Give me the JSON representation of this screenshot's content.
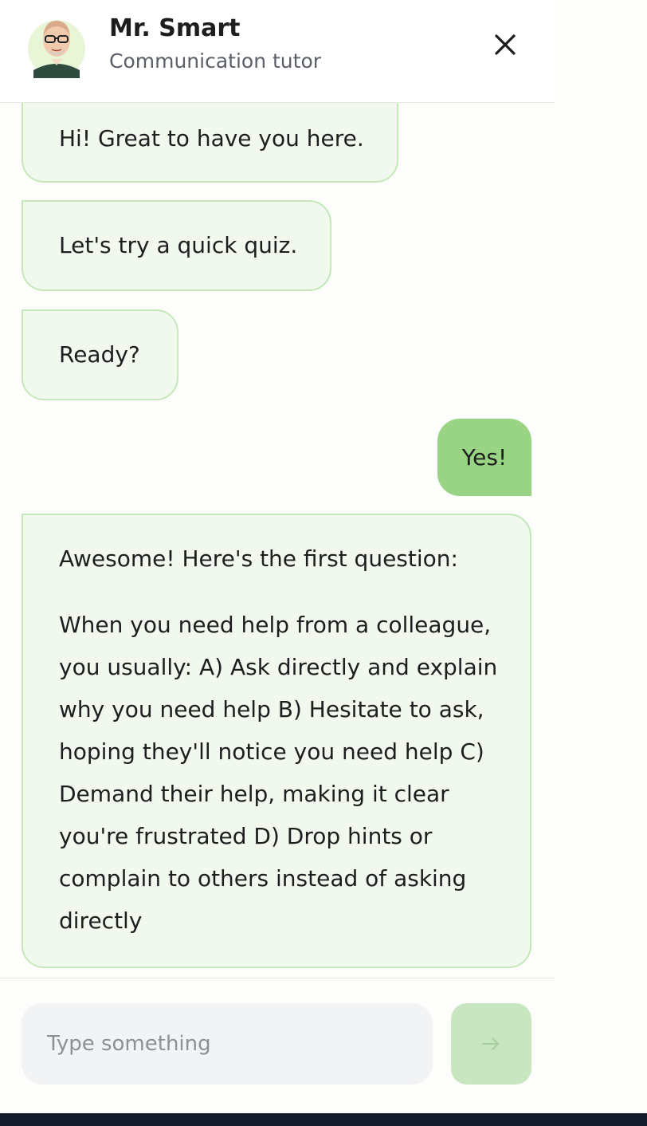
{
  "header": {
    "name": "Mr. Smart",
    "role": "Communication tutor",
    "avatar_icon": "tutor-avatar",
    "close_icon": "close-icon"
  },
  "messages": [
    {
      "sender": "bot",
      "text": "Hi! Great to have you here."
    },
    {
      "sender": "bot",
      "text": "Let's try a quick quiz."
    },
    {
      "sender": "bot",
      "text": "Ready?"
    },
    {
      "sender": "user",
      "text": "Yes!"
    },
    {
      "sender": "bot",
      "intro": "Awesome! Here's the first question:",
      "question": "When you need help from a colleague, you usually: A) Ask directly and explain why you need help B) Hesitate to ask, hoping they'll notice you need help C) Demand their help, making it clear you're frustrated D) Drop hints or complain to others instead of asking directly"
    }
  ],
  "composer": {
    "placeholder": "Type something",
    "value": "",
    "send_icon": "arrow-right-icon"
  },
  "colors": {
    "bot_bubble": "#f1f9ee",
    "bot_border": "#c5e8bb",
    "user_bubble": "#98d484",
    "send_button": "#c8e7c0",
    "bottom_bar": "#121a2b"
  }
}
